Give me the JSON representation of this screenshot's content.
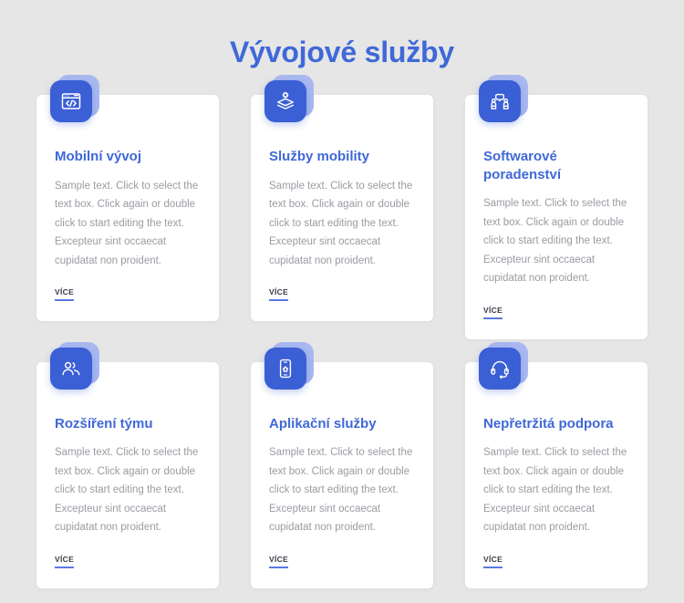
{
  "page": {
    "title": "Vývojové služby",
    "background_color": "#e6e6e6",
    "accent_color": "#3f68d8",
    "badge_color": "#3b5fd4",
    "badge_shadow_color": "#a9b8ef"
  },
  "body_text": "Sample text. Click to select the text box. Click again or double click to start editing the text. Excepteur sint occaecat cupidatat non proident.",
  "more_label": "VÍCE",
  "cards": [
    {
      "title": "Mobilní vývoj",
      "icon": "code-window-icon",
      "body": "Sample text. Click to select the text box. Click again or double click to start editing the text. Excepteur sint occaecat cupidatat non proident.",
      "more_label": "VÍCE"
    },
    {
      "title": "Služby mobility",
      "icon": "layers-gear-icon",
      "body": "Sample text. Click to select the text box. Click again or double click to start editing the text. Excepteur sint occaecat cupidatat non proident.",
      "more_label": "VÍCE"
    },
    {
      "title": "Softwarové poradenství",
      "icon": "consulting-people-icon",
      "body": "Sample text. Click to select the text box. Click again or double click to start editing the text. Excepteur sint occaecat cupidatat non proident.",
      "more_label": "VÍCE"
    },
    {
      "title": "Rozšíření týmu",
      "icon": "team-group-icon",
      "body": "Sample text. Click to select the text box. Click again or double click to start editing the text. Excepteur sint occaecat cupidatat non proident.",
      "more_label": "VÍCE"
    },
    {
      "title": "Aplikační služby",
      "icon": "mobile-app-icon",
      "body": "Sample text. Click to select the text box. Click again or double click to start editing the text. Excepteur sint occaecat cupidatat non proident.",
      "more_label": "VÍCE"
    },
    {
      "title": "Nepřetržitá podpora",
      "icon": "headset-support-icon",
      "body": "Sample text. Click to select the text box. Click again or double click to start editing the text. Excepteur sint occaecat cupidatat non proident.",
      "more_label": "VÍCE"
    }
  ]
}
